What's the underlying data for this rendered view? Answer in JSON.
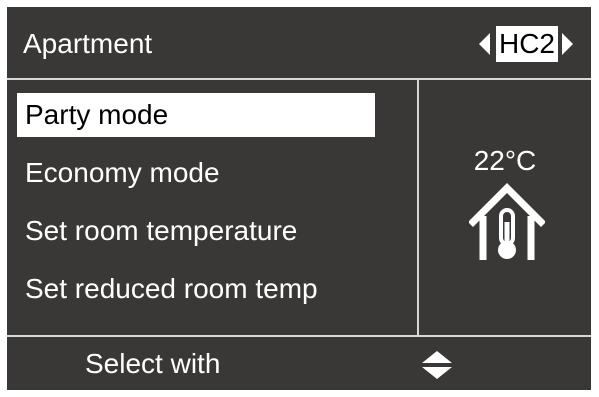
{
  "header": {
    "title": "Apartment",
    "circuit": "HC2"
  },
  "menu": {
    "items": [
      {
        "label": "Party mode",
        "selected": true
      },
      {
        "label": "Economy mode",
        "selected": false
      },
      {
        "label": "Set room temperature",
        "selected": false
      },
      {
        "label": "Set reduced room temp",
        "selected": false
      }
    ]
  },
  "status": {
    "temperature": "22°C",
    "icon": "house-thermometer-icon"
  },
  "footer": {
    "instruction": "Select with",
    "icon": "up-down-arrows-icon"
  },
  "colors": {
    "background": "#3a3836",
    "foreground": "#ffffff",
    "highlight": "#ffffff",
    "divider": "#d7d7d7"
  }
}
